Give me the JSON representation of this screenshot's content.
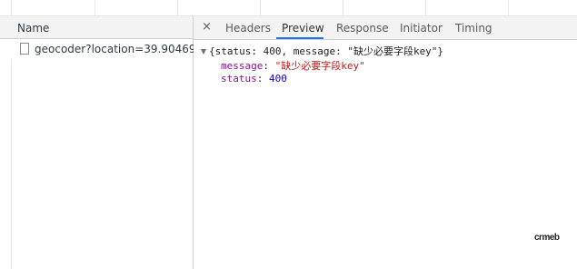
{
  "request_list": {
    "column_name": "Name",
    "rows": [
      {
        "name": "geocoder?location=39.90469,..."
      }
    ]
  },
  "details": {
    "close_glyph": "×",
    "tabs": [
      {
        "label": "Headers",
        "active": false
      },
      {
        "label": "Preview",
        "active": true
      },
      {
        "label": "Response",
        "active": false
      },
      {
        "label": "Initiator",
        "active": false
      },
      {
        "label": "Timing",
        "active": false
      }
    ],
    "preview": {
      "summary": "{status: 400, message: \"缺少必要字段key\"}",
      "message_key": "message",
      "message_value": "\"缺少必要字段key\"",
      "status_key": "status",
      "status_value": "400"
    }
  },
  "watermark": "crmeb",
  "colors": {
    "active_tab_underline": "#1a73e8",
    "json_key": "#881391",
    "json_string": "#c41a16",
    "json_number": "#1c00cf"
  }
}
